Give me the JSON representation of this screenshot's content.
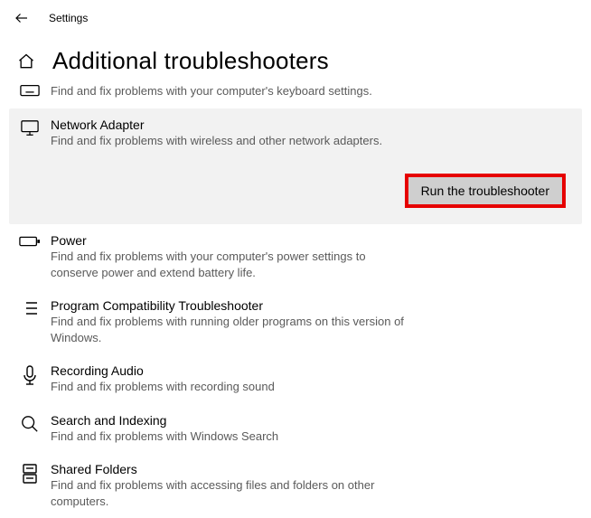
{
  "title": "Settings",
  "heading": "Additional troubleshooters",
  "run_label": "Run the troubleshooter",
  "items": {
    "keyboard": {
      "desc": "Find and fix problems with your computer's keyboard settings."
    },
    "network_adapter": {
      "title": "Network Adapter",
      "desc": "Find and fix problems with wireless and other network adapters."
    },
    "power": {
      "title": "Power",
      "desc": "Find and fix problems with your computer's power settings to conserve power and extend battery life."
    },
    "program_compat": {
      "title": "Program Compatibility Troubleshooter",
      "desc": "Find and fix problems with running older programs on this version of Windows."
    },
    "recording_audio": {
      "title": "Recording Audio",
      "desc": "Find and fix problems with recording sound"
    },
    "search_indexing": {
      "title": "Search and Indexing",
      "desc": "Find and fix problems with Windows Search"
    },
    "shared_folders": {
      "title": "Shared Folders",
      "desc": "Find and fix problems with accessing files and folders on other computers."
    }
  }
}
